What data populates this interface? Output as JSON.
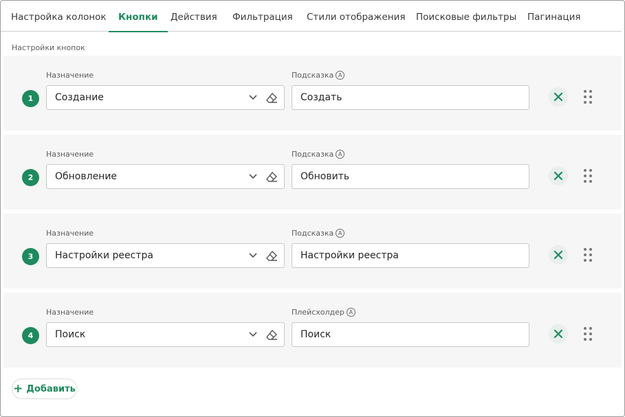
{
  "tabs": [
    {
      "label": "Настройка колонок"
    },
    {
      "label": "Кнопки"
    },
    {
      "label": "Действия"
    },
    {
      "label": "Фильтрация"
    },
    {
      "label": "Стили отображения"
    },
    {
      "label": "Поисковые фильтры"
    },
    {
      "label": "Пагинация"
    }
  ],
  "active_tab": "Кнопки",
  "section_title": "Настройки кнопок",
  "rows": [
    {
      "number": "1",
      "purpose_label": "Назначение",
      "purpose_value": "Создание",
      "hint_label": "Подсказка",
      "hint_value": "Создать"
    },
    {
      "number": "2",
      "purpose_label": "Назначение",
      "purpose_value": "Обновление",
      "hint_label": "Подсказка",
      "hint_value": "Обновить"
    },
    {
      "number": "3",
      "purpose_label": "Назначение",
      "purpose_value": "Настройки реестра",
      "hint_label": "Подсказка",
      "hint_value": "Настройки реестра"
    },
    {
      "number": "4",
      "purpose_label": "Назначение",
      "purpose_value": "Поиск",
      "hint_label": "Плейсхолдер",
      "hint_value": "Поиск"
    }
  ],
  "add_button": {
    "label": "Добавить",
    "icon": "plus-icon"
  },
  "icons": {
    "auto": "A",
    "clear": "eraser-icon",
    "dropdown": "chevron-down-icon",
    "delete": "close-icon",
    "drag": "drag-handle-icon"
  },
  "colors": {
    "accent": "#1e8a5e",
    "row_bg": "#f6f6f6"
  }
}
